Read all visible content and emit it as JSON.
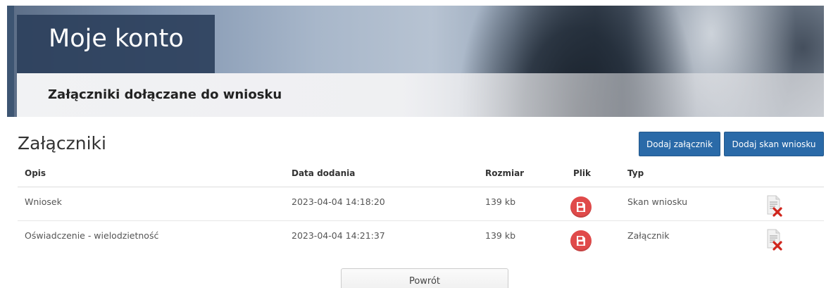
{
  "banner": {
    "title": "Moje konto",
    "subtitle": "Załączniki dołączane do wniosku"
  },
  "section": {
    "title": "Załączniki",
    "add_attachment_label": "Dodaj załącznik",
    "add_scan_label": "Dodaj skan wniosku"
  },
  "table": {
    "headers": [
      "Opis",
      "Data dodania",
      "Rozmiar",
      "Plik",
      "Typ"
    ],
    "rows": [
      {
        "opis": "Wniosek",
        "data": "2023-04-04 14:18:20",
        "rozmiar": "139 kb",
        "plik_icon": "file-download-icon",
        "typ": "Skan wniosku",
        "action_icon": "delete-document-icon"
      },
      {
        "opis": "Oświadczenie - wielodzietność",
        "data": "2023-04-04 14:21:37",
        "rozmiar": "139 kb",
        "plik_icon": "file-download-icon",
        "typ": "Załącznik",
        "action_icon": "delete-document-icon"
      }
    ]
  },
  "footer": {
    "back_label": "Powrót"
  },
  "colors": {
    "primary_button": "#2a6aa8",
    "file_icon": "#e04a4a",
    "delete_x": "#d0251c",
    "banner_title_bg": "#2c405c"
  }
}
